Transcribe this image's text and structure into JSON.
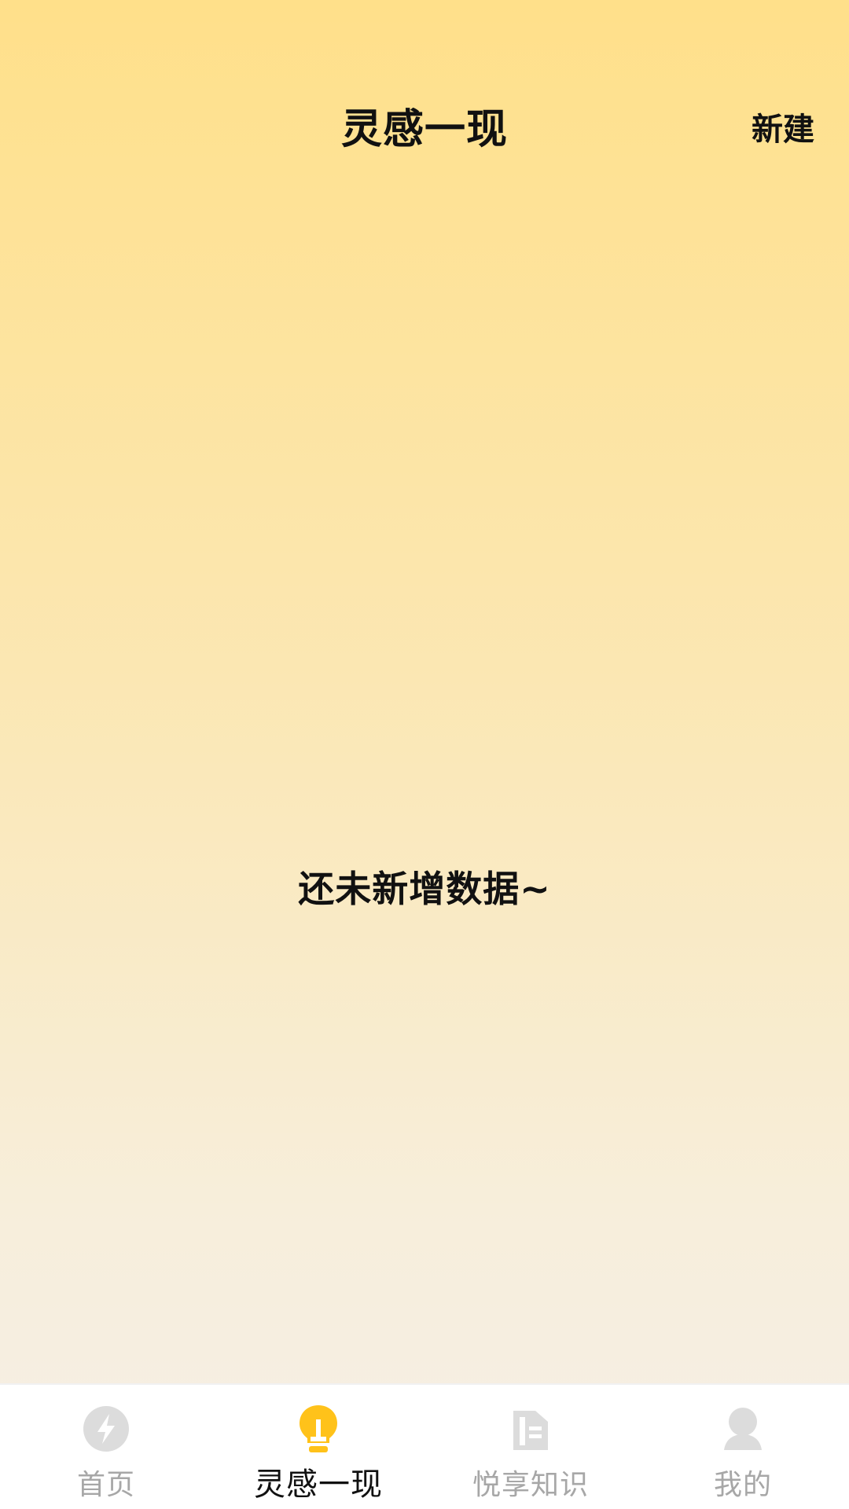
{
  "header": {
    "title": "灵感一现",
    "new_label": "新建"
  },
  "empty_state": {
    "message": "还未新增数据~"
  },
  "tabbar": {
    "active_index": 1,
    "colors": {
      "active_icon": "#FFC21A",
      "inactive_icon": "#DCDCDC",
      "active_text": "#111111",
      "inactive_text": "#A7A7A7"
    },
    "tabs": [
      {
        "label": "首页",
        "icon": "lightning-icon"
      },
      {
        "label": "灵感一现",
        "icon": "lightbulb-icon"
      },
      {
        "label": "悦享知识",
        "icon": "document-icon"
      },
      {
        "label": "我的",
        "icon": "user-icon"
      }
    ]
  }
}
